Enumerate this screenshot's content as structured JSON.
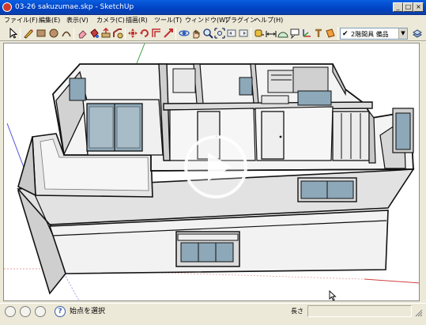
{
  "window": {
    "title": "03-26 sakuzumae.skp - SketchUp",
    "buttons": {
      "minimize": "_",
      "maximize": "□",
      "close": "×"
    }
  },
  "menu": [
    "ファイル(F)",
    "編集(E)",
    "表示(V)",
    "カメラ(C)",
    "描画(R)",
    "ツール(T)",
    "ウィンドウ(W)",
    "プラグイン",
    "ヘルプ(H)"
  ],
  "toolbar": {
    "icons": [
      "select-icon",
      "pencil-icon",
      "rectangle-icon",
      "circle-icon",
      "arc-icon",
      "eraser-icon",
      "paint-bucket-icon",
      "push-pull-icon",
      "follow-me-icon",
      "move-icon",
      "rotate-icon",
      "offset-icon",
      "orbit-icon",
      "pan-icon",
      "zoom-icon",
      "zoom-extents-icon",
      "previous-view-icon",
      "tape-measure-icon",
      "dimension-icon",
      "protractor-icon",
      "text-icon",
      "axes-icon",
      "3d-text-icon",
      "section-plane-icon"
    ],
    "layer_check": "✔",
    "layer_name": "2階間具 備品",
    "layer_dropdown": "▼"
  },
  "viewport": {
    "play_button": "play-icon",
    "model": "two-story house cutaway"
  },
  "status": {
    "hint": "始点を選択",
    "help_icon": "?",
    "measurements_label": "長さ",
    "measurements_value": ""
  },
  "colors": {
    "titlebar": "#0a4ed0",
    "chrome": "#ece9d8",
    "axis_red": "#d04040",
    "axis_green": "#3aa03a",
    "axis_blue": "#3a3ad0",
    "wall": "#f2f2f2",
    "wall_shade": "#cfcfcf",
    "glass": "#8da8b8"
  }
}
